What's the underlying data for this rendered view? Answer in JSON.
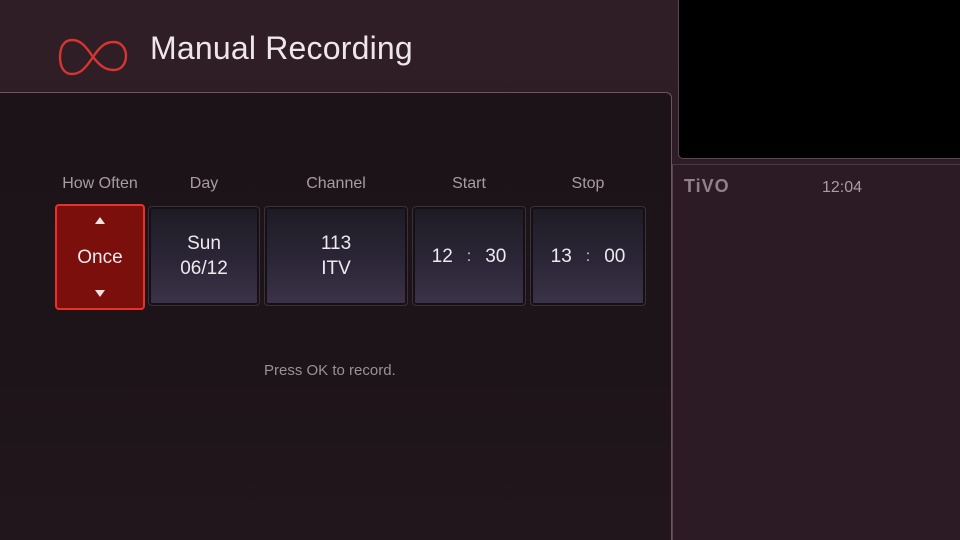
{
  "header": {
    "title": "Manual Recording"
  },
  "columns": {
    "how_often": "How Often",
    "day": "Day",
    "channel": "Channel",
    "start": "Start",
    "stop": "Stop"
  },
  "fields": {
    "how_often": "Once",
    "day": {
      "name": "Sun",
      "date": "06/12"
    },
    "channel": {
      "number": "113",
      "name": "ITV"
    },
    "start": {
      "hour": "12",
      "sep": ":",
      "minute": "30"
    },
    "stop": {
      "hour": "13",
      "sep": ":",
      "minute": "00"
    }
  },
  "hint": "Press OK to record.",
  "side": {
    "brand": "TiVO",
    "clock": "12:04"
  },
  "colors": {
    "accent": "#e8312a",
    "selected_bg": "#7a0f0b",
    "background": "#2a1a22"
  },
  "icons": {
    "logo": "virgin-infinity-logo",
    "up": "arrow-up-icon",
    "down": "arrow-down-icon"
  }
}
